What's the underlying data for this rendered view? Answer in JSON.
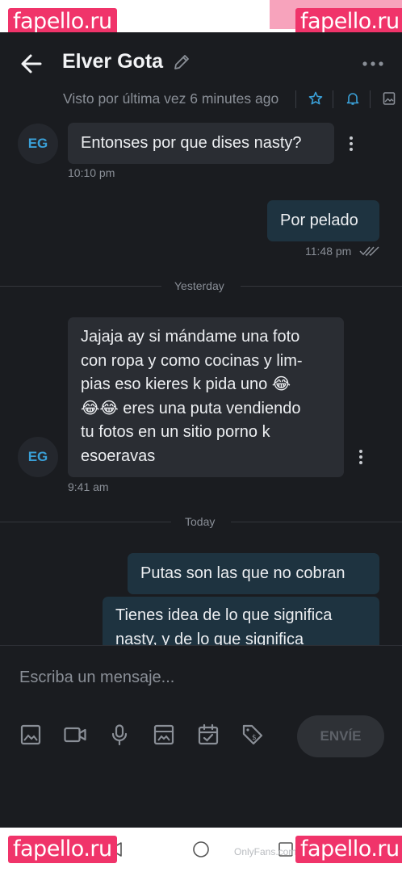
{
  "header": {
    "title": "Elver Gota",
    "last_seen": "Visto por última vez 6 minutes ago"
  },
  "messages": [
    {
      "direction": "in",
      "avatar": "EG",
      "text": "Entonses por que dises nasty?",
      "time": "10:10 pm"
    },
    {
      "direction": "out",
      "text": "Por pelado",
      "time": "11:48 pm",
      "read": true
    },
    {
      "type": "separator",
      "label": "Yesterday"
    },
    {
      "direction": "in",
      "avatar": "EG",
      "lines": [
        "Jajaja ay si mándame una foto",
        "con ropa y como cocinas y lim-",
        "pias eso kieres k pida uno 😂",
        "😂😂 eres una puta vendiendo",
        "tu fotos en un sitio porno k",
        "esoeravas"
      ],
      "time": "9:41 am"
    },
    {
      "type": "separator",
      "label": "Today"
    },
    {
      "direction": "out",
      "text": "Putas son las que no cobran"
    },
    {
      "direction": "out",
      "lines": [
        "Tienes idea de lo que significa",
        "nasty, y de lo que significa"
      ]
    }
  ],
  "composer": {
    "placeholder": "Escriba un mensaje...",
    "send_label": "ENVÍE",
    "tools": [
      "image-icon",
      "video-icon",
      "microphone-icon",
      "vault-icon",
      "calendar-icon",
      "price-tag-icon"
    ]
  },
  "watermark": {
    "text": "fapello.ru"
  },
  "credit": "OnlyFans.com/chubbychunky",
  "colors": {
    "accent": "#3aa0d8",
    "incoming_bubble": "#2a2d33",
    "outgoing_bubble": "#1e3340",
    "watermark": "#f0346a"
  }
}
